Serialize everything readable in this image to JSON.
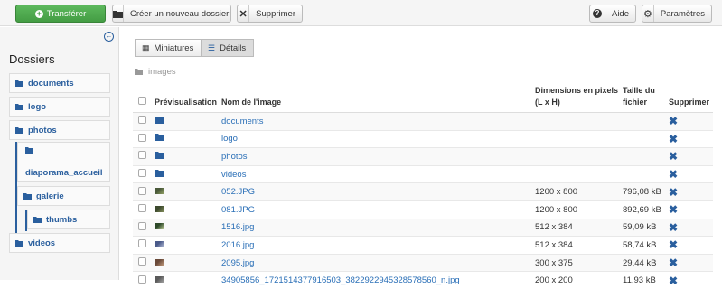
{
  "toolbar": {
    "upload_label": "Transférer",
    "new_folder_label": "Créer un nouveau dossier",
    "delete_label": "Supprimer",
    "help_label": "Aide",
    "settings_label": "Paramètres"
  },
  "sidebar": {
    "title": "Dossiers",
    "folders": [
      "documents",
      "logo",
      "photos",
      "diaporama_accueil",
      "galerie",
      "thumbs",
      "videos"
    ]
  },
  "view": {
    "thumbnails_label": "Miniatures",
    "details_label": "Détails"
  },
  "breadcrumb": "images",
  "table": {
    "headers": {
      "preview": "Prévisualisation",
      "name": "Nom de l'image",
      "dimensions": "Dimensions en pixels (L x H)",
      "size": "Taille du fichier",
      "delete": "Supprimer"
    },
    "rows": [
      {
        "type": "folder",
        "name": "documents",
        "dims": "",
        "size": ""
      },
      {
        "type": "folder",
        "name": "logo",
        "dims": "",
        "size": ""
      },
      {
        "type": "folder",
        "name": "photos",
        "dims": "",
        "size": ""
      },
      {
        "type": "folder",
        "name": "videos",
        "dims": "",
        "size": ""
      },
      {
        "type": "image",
        "name": "052.JPG",
        "dims": "1200 x 800",
        "size": "796,08 kB"
      },
      {
        "type": "image",
        "name": "081.JPG",
        "dims": "1200 x 800",
        "size": "892,69 kB"
      },
      {
        "type": "image",
        "name": "1516.jpg",
        "dims": "512 x 384",
        "size": "59,09 kB"
      },
      {
        "type": "image",
        "name": "2016.jpg",
        "dims": "512 x 384",
        "size": "58,74 kB"
      },
      {
        "type": "image",
        "name": "2095.jpg",
        "dims": "300 x 375",
        "size": "29,44 kB"
      },
      {
        "type": "image",
        "name": "34905856_1721514377916503_3822922945328578560_n.jpg",
        "dims": "200 x 200",
        "size": "11,93 kB"
      }
    ]
  },
  "colors": {
    "accent": "#2a5f9e",
    "upload": "#449d44"
  }
}
